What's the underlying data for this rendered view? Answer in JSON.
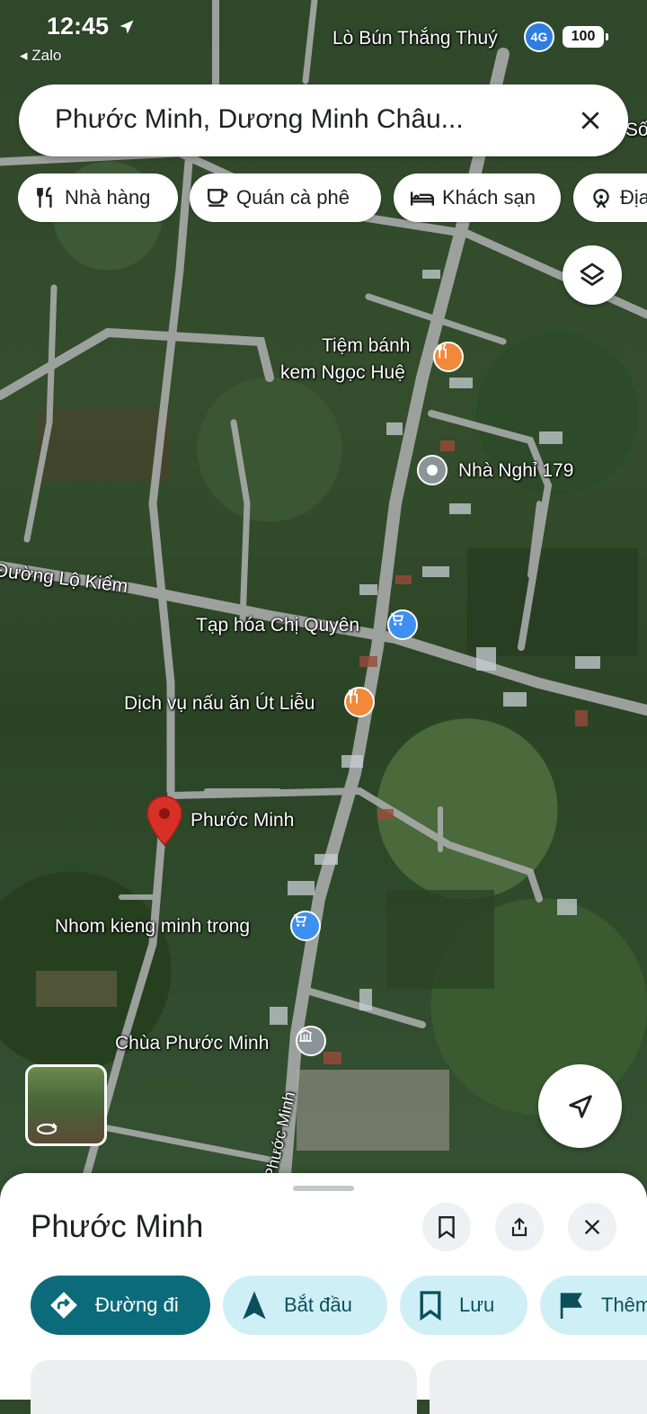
{
  "status_bar": {
    "time": "12:45",
    "back_app": "◂ Zalo",
    "network": "4G",
    "battery": "100"
  },
  "search": {
    "query": "Phước Minh, Dương Minh Châu..."
  },
  "chips": [
    {
      "label": "Nhà hàng",
      "icon": "restaurant-icon"
    },
    {
      "label": "Quán cà phê",
      "icon": "coffee-icon"
    },
    {
      "label": "Khách sạn",
      "icon": "hotel-icon"
    },
    {
      "label": "Địa",
      "icon": "attraction-icon"
    }
  ],
  "map": {
    "labels": {
      "lo_bun": "Lò Bún Thắng Thuý",
      "so": "Số",
      "tiem_banh_1": "Tiệm bánh",
      "tiem_banh_2": "kem Ngọc Huệ",
      "nha_nghi": "Nhà Nghỉ 179",
      "duong_lo_kiem": "Đường Lộ Kiểm",
      "tap_hoa": "Tạp hóa Chị Quyên",
      "dich_vu": "Dịch vụ nấu ăn Út Liễu",
      "phuoc_minh_pin": "Phước Minh",
      "nhom_kieng": "Nhom kieng minh trong",
      "chua": "Chùa Phước Minh",
      "road_phuoc_minh": "Phước Minh"
    },
    "pin_colors": {
      "food": "#f2883a",
      "shop": "#3d8ff0",
      "lodging": "#8a9499",
      "selected": "#d93025"
    }
  },
  "sheet": {
    "title": "Phước Minh",
    "actions": [
      {
        "label": "Đường đi",
        "icon": "directions-icon"
      },
      {
        "label": "Bắt đầu",
        "icon": "navigation-icon"
      },
      {
        "label": "Lưu",
        "icon": "bookmark-icon"
      },
      {
        "label": "Thêm",
        "icon": "flag-icon"
      }
    ]
  }
}
